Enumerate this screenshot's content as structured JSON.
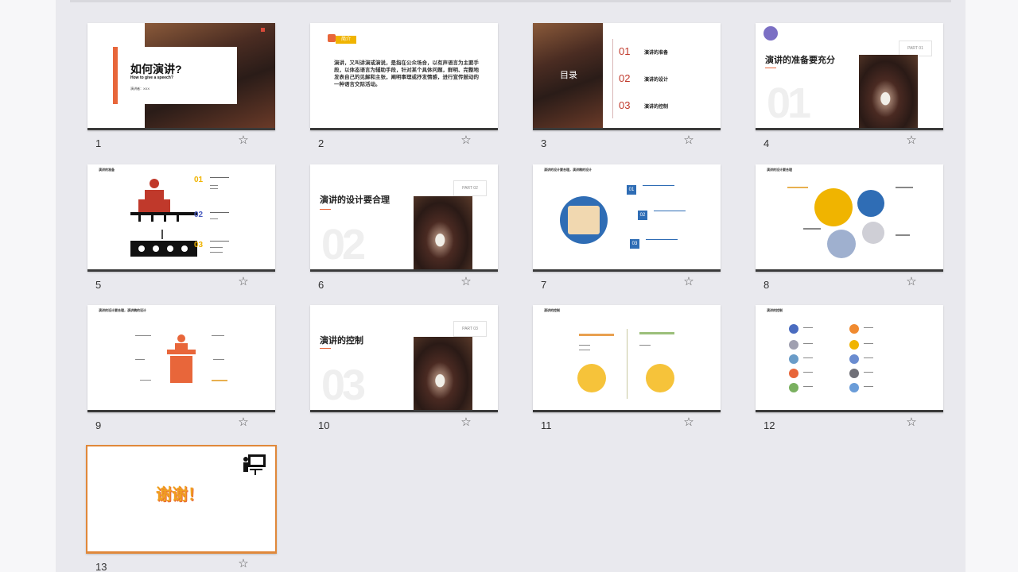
{
  "slides": [
    {
      "number": "1",
      "title": "如何演讲?",
      "subtitle": "How to give a speech?",
      "presenter": "演讲者：XXX"
    },
    {
      "number": "2",
      "badge": "简介",
      "body": "演讲，又叫讲演或演说，是指在公众场合，以有声语言为主要手段，以体态语言为辅助手段，针对某个具体问题，鲜明、完整地发表自己的见解和主张，阐明事理或抒发情感，进行宣传鼓动的一种语言交际活动。"
    },
    {
      "number": "3",
      "toc_title": "目录",
      "items": [
        {
          "num": "01",
          "label": "演讲的准备"
        },
        {
          "num": "02",
          "label": "演讲的设计"
        },
        {
          "num": "03",
          "label": "演讲的控制"
        }
      ]
    },
    {
      "number": "4",
      "title": "演讲的准备要充分",
      "part": "PART 01",
      "big_num": "01"
    },
    {
      "number": "5",
      "header": "演讲的准备",
      "items": [
        {
          "num": "01"
        },
        {
          "num": "02"
        },
        {
          "num": "03"
        }
      ]
    },
    {
      "number": "6",
      "title": "演讲的设计要合理",
      "part": "PART 02",
      "big_num": "02"
    },
    {
      "number": "7",
      "header": "演讲的设计要合理，演讲稿的设计",
      "items": [
        {
          "num": "01"
        },
        {
          "num": "02"
        },
        {
          "num": "03"
        }
      ]
    },
    {
      "number": "8",
      "header": "演讲的设计要合理"
    },
    {
      "number": "9",
      "header": "演讲的设计要合理，演讲稿的设计"
    },
    {
      "number": "10",
      "title": "演讲的控制",
      "part": "PART 03",
      "big_num": "03"
    },
    {
      "number": "11",
      "header": "演讲的控制"
    },
    {
      "number": "12",
      "header": "演讲的控制"
    },
    {
      "number": "13",
      "thanks": "谢谢！"
    }
  ],
  "colors": {
    "accent_orange": "#e8663a",
    "accent_red": "#c0392b",
    "gold": "#f0b400",
    "blue": "#2f6db5",
    "sorter_bg": "#e9e9ee",
    "selected_border": "#e0883a"
  },
  "icons": {
    "favorite": "star-icon",
    "presenter": "presenter-icon"
  }
}
